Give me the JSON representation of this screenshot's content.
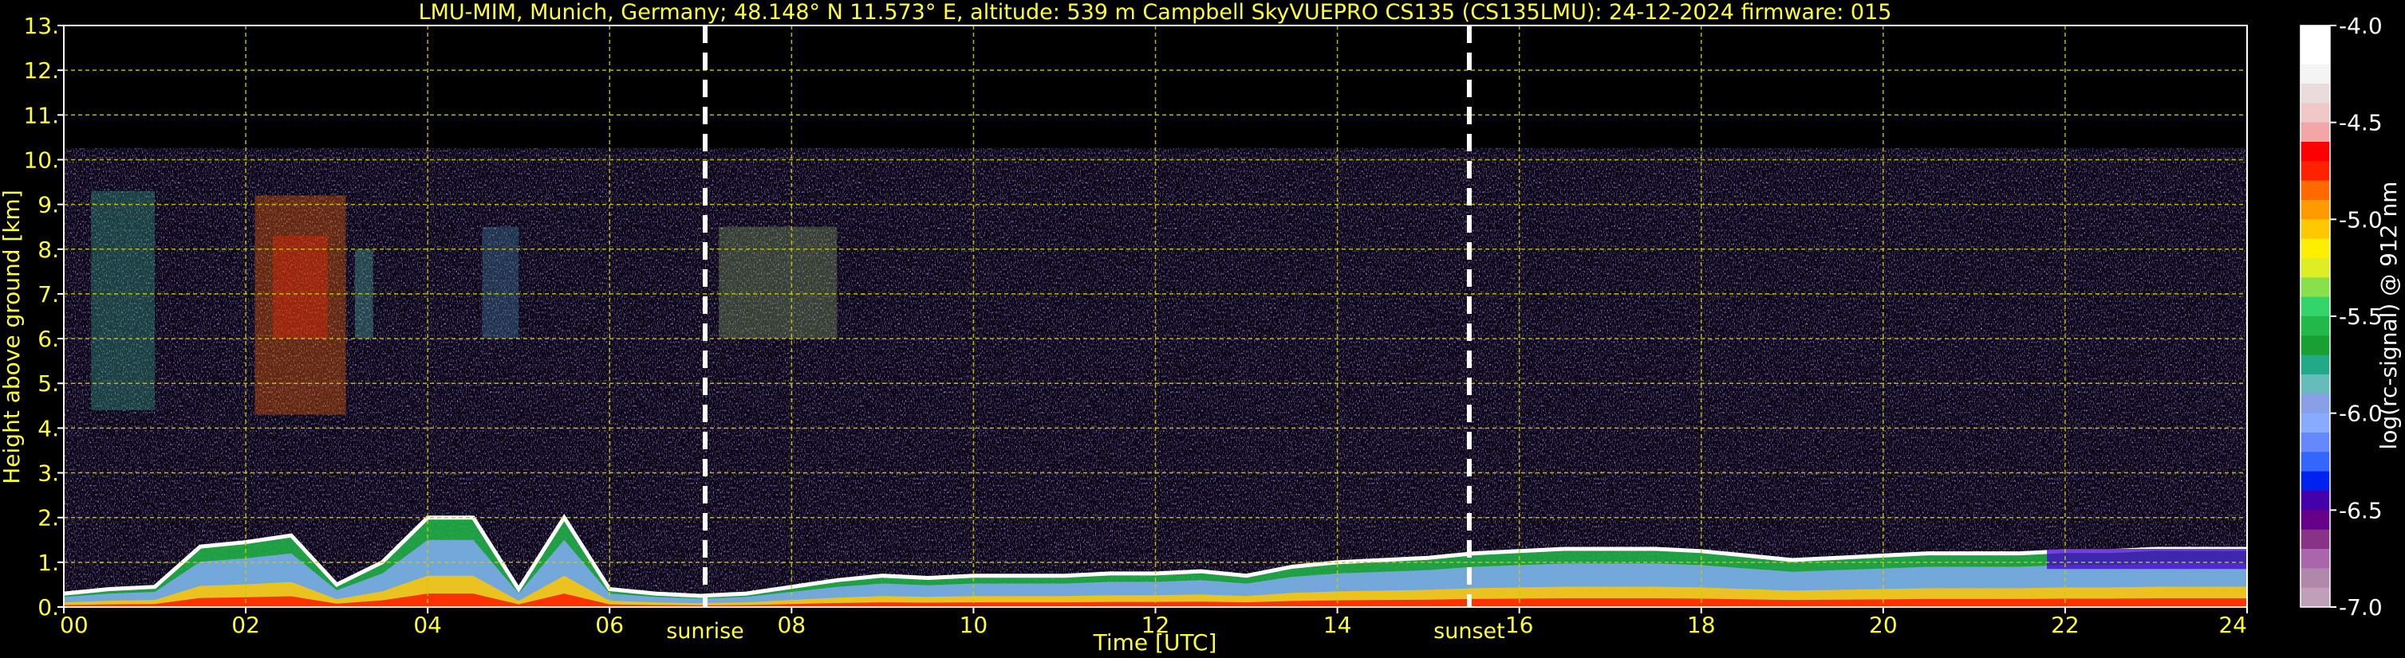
{
  "chart_data": {
    "type": "heatmap",
    "title": "LMU-MIM, Munich, Germany; 48.148° N 11.573° E, altitude: 539 m    Campbell SkyVUEPRO CS135 (CS135LMU): 24-12-2024    firmware: 015",
    "xlabel": "Time [UTC]",
    "ylabel": "Height above ground [km]",
    "xlim": [
      0,
      24
    ],
    "ylim": [
      0,
      13
    ],
    "x_ticks": [
      "00",
      "02",
      "04",
      "06",
      "08",
      "10",
      "12",
      "14",
      "16",
      "18",
      "20",
      "22",
      "24"
    ],
    "y_ticks": [
      "0.",
      "1.",
      "2.",
      "3.",
      "4.",
      "5.",
      "6.",
      "7.",
      "8.",
      "9.",
      "10.",
      "11.",
      "12.",
      "13."
    ],
    "grid": true,
    "markers": [
      {
        "label": "sunrise",
        "time": 7.05
      },
      {
        "label": "sunset",
        "time": 15.45
      }
    ],
    "data_top_km": 10.25,
    "colorbar": {
      "label": "log(rc-signal) @ 912 nm",
      "range": [
        -7.0,
        -4.0
      ],
      "ticks": [
        "-4.0",
        "-4.5",
        "-5.0",
        "-5.5",
        "-6.0",
        "-6.5",
        "-7.0"
      ],
      "colors": [
        "#ffffff",
        "#ffffff",
        "#f4f4f4",
        "#eadcdc",
        "#f0c8c8",
        "#f2a6a6",
        "#ff0000",
        "#ff2200",
        "#ff6a00",
        "#ff9a00",
        "#ffc800",
        "#ffee00",
        "#ddee22",
        "#88e04a",
        "#33d46a",
        "#22b84a",
        "#1aa032",
        "#22aa88",
        "#66bbbb",
        "#88a0e8",
        "#88aaff",
        "#6688ff",
        "#3366ff",
        "#0022ee",
        "#4400aa",
        "#660088",
        "#883388",
        "#aa66aa",
        "#b088aa",
        "#c0a0b8"
      ]
    },
    "profile": {
      "times": [
        0,
        0.5,
        1,
        1.5,
        2,
        2.5,
        3,
        3.5,
        4,
        4.5,
        5,
        5.5,
        6,
        6.5,
        7,
        7.5,
        8,
        8.5,
        9,
        9.5,
        10,
        10.5,
        11,
        11.5,
        12,
        12.5,
        13,
        13.5,
        14,
        14.5,
        15,
        15.5,
        16,
        16.5,
        17,
        17.5,
        18,
        18.5,
        19,
        19.5,
        20,
        20.5,
        21,
        21.5,
        22,
        22.5,
        23,
        23.5,
        24
      ],
      "boundary_layer_km": [
        0.3,
        0.4,
        0.45,
        1.35,
        1.45,
        1.6,
        0.5,
        1.0,
        2.0,
        2.0,
        0.4,
        2.0,
        0.4,
        0.3,
        0.25,
        0.3,
        0.45,
        0.6,
        0.7,
        0.65,
        0.7,
        0.7,
        0.7,
        0.75,
        0.75,
        0.8,
        0.7,
        0.9,
        1.0,
        1.05,
        1.1,
        1.2,
        1.25,
        1.3,
        1.3,
        1.3,
        1.25,
        1.15,
        1.05,
        1.1,
        1.15,
        1.2,
        1.2,
        1.2,
        1.25,
        1.25,
        1.3,
        1.3,
        1.3
      ]
    }
  }
}
